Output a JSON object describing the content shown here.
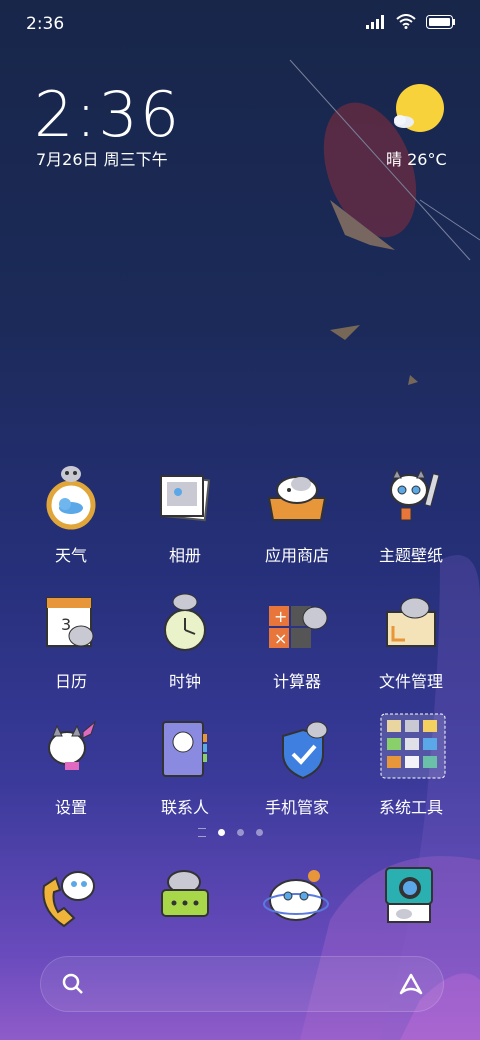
{
  "status_bar": {
    "time": "2:36"
  },
  "clock_widget": {
    "time": "2:36",
    "date": "7月26日 周三下午"
  },
  "weather_widget": {
    "text": "晴 26°C"
  },
  "apps": [
    {
      "label": "天气"
    },
    {
      "label": "相册"
    },
    {
      "label": "应用商店"
    },
    {
      "label": "主题壁纸"
    },
    {
      "label": "日历"
    },
    {
      "label": "时钟"
    },
    {
      "label": "计算器"
    },
    {
      "label": "文件管理"
    },
    {
      "label": "设置"
    },
    {
      "label": "联系人"
    },
    {
      "label": "手机管家"
    },
    {
      "label": "系统工具"
    }
  ],
  "calendar_day": "3",
  "page_indicator": {
    "pages": 3,
    "current": 1
  },
  "colors": {
    "sun": "#f8d23a",
    "accent": "#5aa8e8"
  }
}
